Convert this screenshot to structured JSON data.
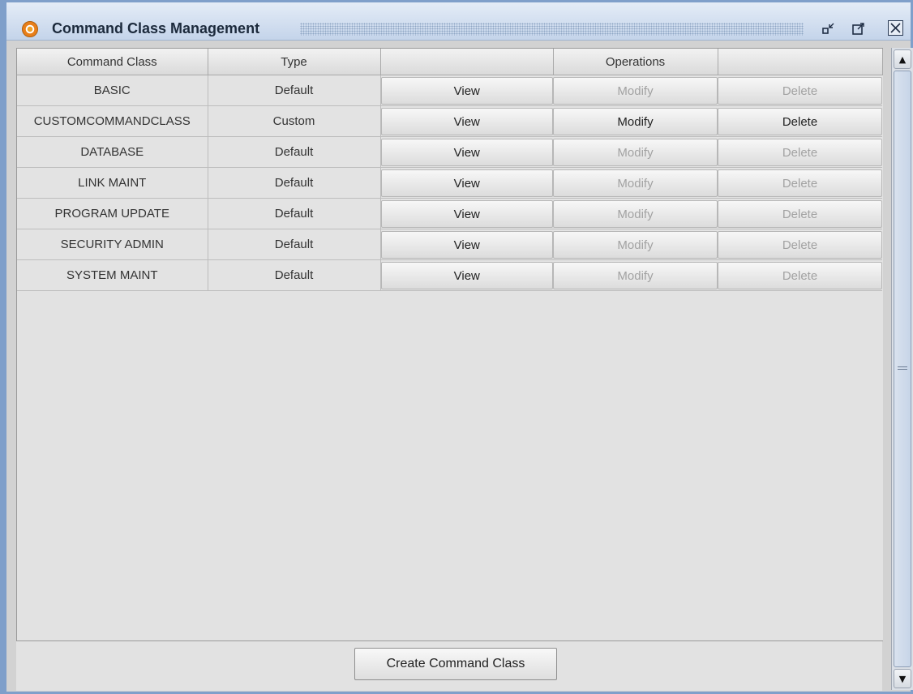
{
  "window": {
    "title": "Command Class Management",
    "controls": {
      "minimize_icon": "minimize-icon",
      "maximize_icon": "maximize-icon",
      "close_icon": "close-icon"
    }
  },
  "table": {
    "headers": [
      "Command Class",
      "Type",
      "",
      "Operations",
      ""
    ],
    "rows": [
      {
        "name": "BASIC",
        "type": "Default",
        "view": "View",
        "modify": "Modify",
        "delete": "Delete",
        "modify_enabled": false,
        "delete_enabled": false
      },
      {
        "name": "CUSTOMCOMMANDCLASS",
        "type": "Custom",
        "view": "View",
        "modify": "Modify",
        "delete": "Delete",
        "modify_enabled": true,
        "delete_enabled": true
      },
      {
        "name": "DATABASE",
        "type": "Default",
        "view": "View",
        "modify": "Modify",
        "delete": "Delete",
        "modify_enabled": false,
        "delete_enabled": false
      },
      {
        "name": "LINK MAINT",
        "type": "Default",
        "view": "View",
        "modify": "Modify",
        "delete": "Delete",
        "modify_enabled": false,
        "delete_enabled": false
      },
      {
        "name": "PROGRAM UPDATE",
        "type": "Default",
        "view": "View",
        "modify": "Modify",
        "delete": "Delete",
        "modify_enabled": false,
        "delete_enabled": false
      },
      {
        "name": "SECURITY ADMIN",
        "type": "Default",
        "view": "View",
        "modify": "Modify",
        "delete": "Delete",
        "modify_enabled": false,
        "delete_enabled": false
      },
      {
        "name": "SYSTEM MAINT",
        "type": "Default",
        "view": "View",
        "modify": "Modify",
        "delete": "Delete",
        "modify_enabled": false,
        "delete_enabled": false
      }
    ]
  },
  "footer": {
    "create_label": "Create Command Class"
  },
  "colors": {
    "disabled_text": "#a2a2a2",
    "enabled_text": "#222222",
    "window_border": "#7f9fca"
  }
}
